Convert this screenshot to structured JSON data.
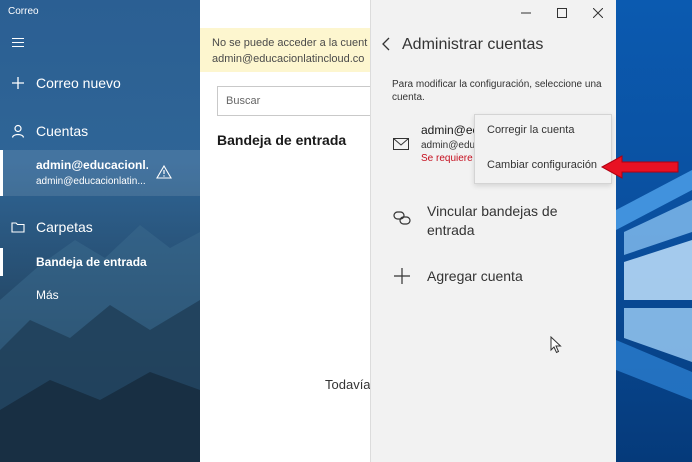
{
  "app": {
    "title": "Correo"
  },
  "sidebar": {
    "new_mail": "Correo nuevo",
    "accounts_label": "Cuentas",
    "account": {
      "name": "admin@educacionl...",
      "email": "admin@educacionlatin..."
    },
    "folders_label": "Carpetas",
    "inbox": "Bandeja de entrada",
    "more": "Más"
  },
  "middle": {
    "banner_line1": "No se puede acceder a la cuent",
    "banner_line2": "admin@educacionlatincloud.co",
    "search_placeholder": "Buscar",
    "inbox_title": "Bandeja de entrada",
    "empty_text": "Todavía"
  },
  "panel": {
    "title": "Administrar cuentas",
    "instructions": "Para modificar la configuración, seleccione una cuenta.",
    "account": {
      "name": "admin@ec",
      "email": "admin@edu",
      "error": "Se requiere a"
    },
    "link_inboxes": "Vincular bandejas de entrada",
    "add_account": "Agregar cuenta"
  },
  "context_menu": {
    "items": [
      "Corregir la cuenta",
      "Cambiar configuración"
    ]
  },
  "colors": {
    "sidebar": "#2b5f93",
    "banner": "#fdf6cf",
    "error": "#c50f1f",
    "arrow": "#e81123",
    "desktop": "#0a4f9e"
  },
  "icons": [
    "hamburger-icon",
    "plus-icon",
    "person-icon",
    "warning-icon",
    "folder-icon",
    "back-icon",
    "mail-icon",
    "link-icon",
    "add-icon",
    "minimize-icon",
    "maximize-icon",
    "close-icon",
    "red-arrow-icon",
    "mouse-cursor-icon"
  ]
}
